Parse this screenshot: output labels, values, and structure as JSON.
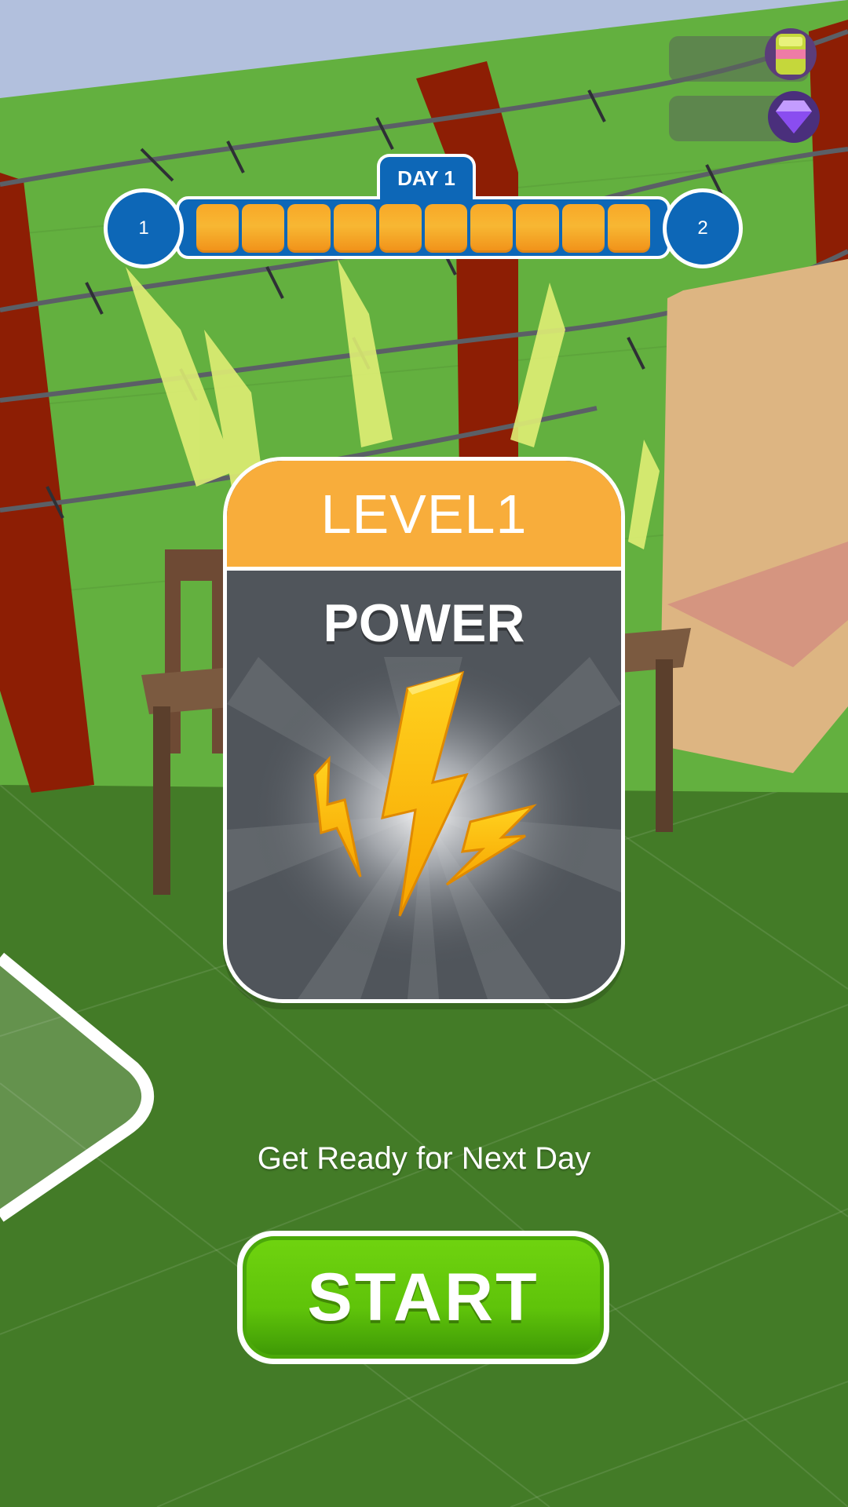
{
  "hud": {
    "cash_value": "",
    "gem_value": ""
  },
  "progress": {
    "day_label": "DAY 1",
    "start_level": "1",
    "end_level": "2",
    "segments_filled": 10,
    "segments_total": 10
  },
  "card": {
    "level_label": "LEVEL1",
    "title": "POWER",
    "icon": "lightning-bolts-icon"
  },
  "footer": {
    "message": "Get Ready for Next Day",
    "start_label": "START"
  },
  "colors": {
    "accent_blue": "#0d67b7",
    "progress_orange": "#f7b733",
    "card_header": "#f8ad3b",
    "card_body": "#50555b",
    "start_green": "#5fc30a"
  }
}
